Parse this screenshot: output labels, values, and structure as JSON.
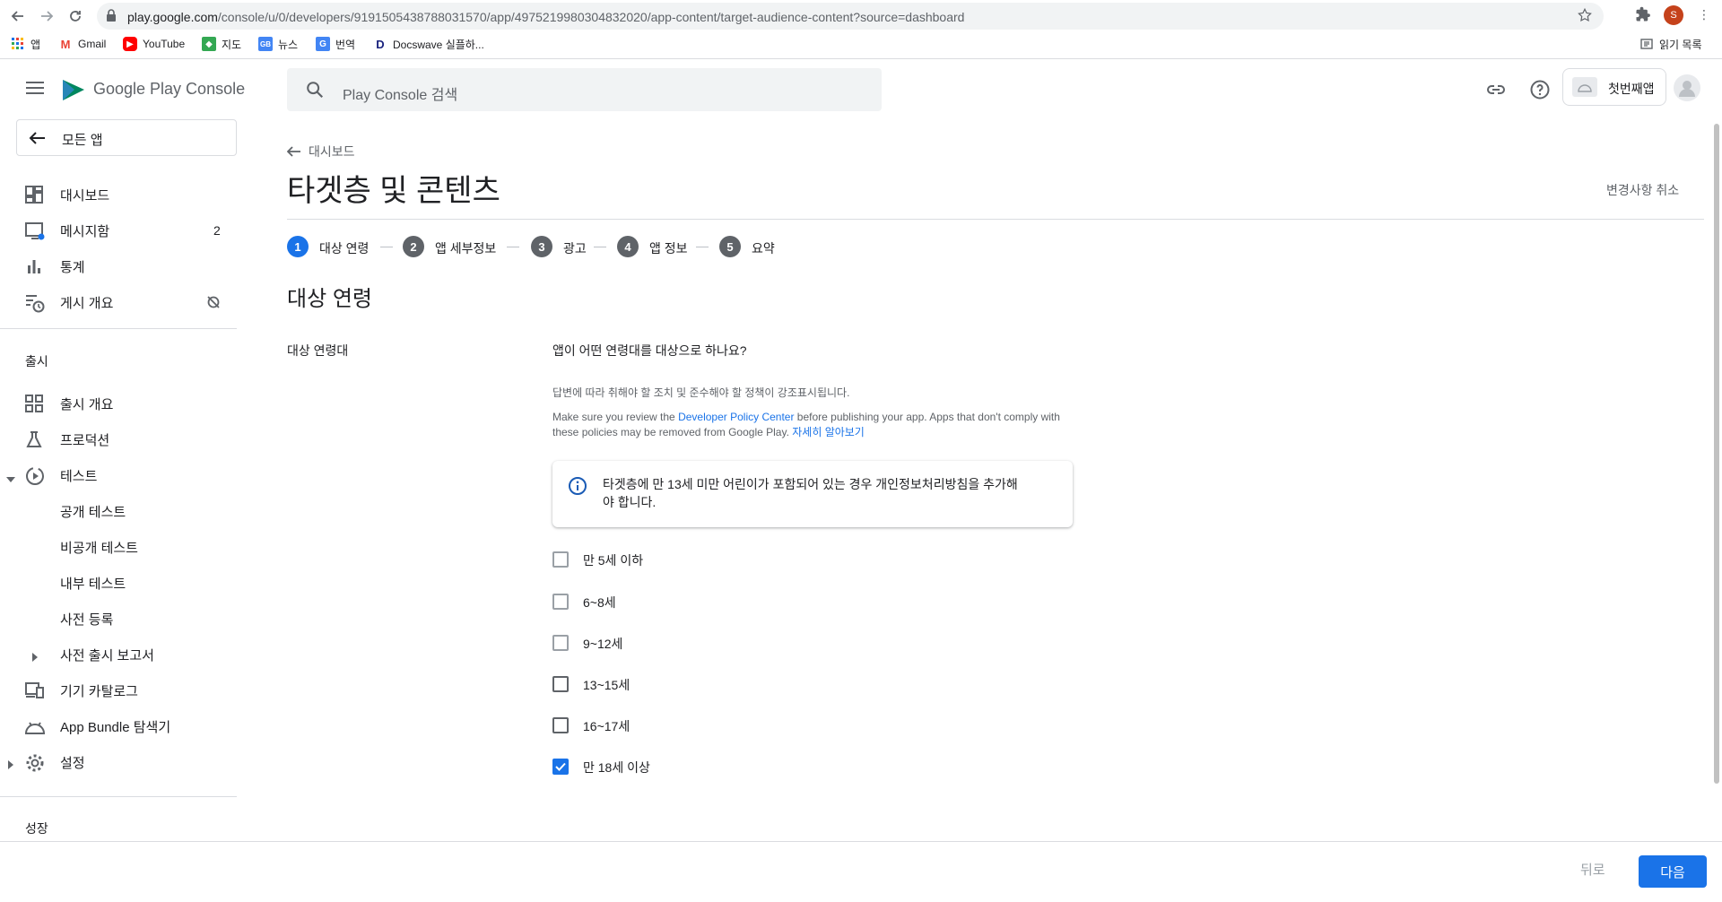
{
  "browser": {
    "url_host": "play.google.com",
    "url_path": "/console/u/0/developers/9191505438788031570/app/4975219980304832020/app-content/target-audience-content?source=dashboard",
    "profile_initial": "S",
    "bookmarks": [
      "앱",
      "Gmail",
      "YouTube",
      "지도",
      "뉴스",
      "번역",
      "Docswave 실플하..."
    ],
    "reading_list": "읽기 목록"
  },
  "header": {
    "logo_text": "Google Play Console",
    "search_placeholder": "Play Console 검색",
    "app_name": "첫번째앱"
  },
  "sidebar": {
    "all_apps": "모든 앱",
    "items": [
      {
        "label": "대시보드"
      },
      {
        "label": "메시지함",
        "badge": "2"
      },
      {
        "label": "통계"
      },
      {
        "label": "게시 개요"
      }
    ],
    "release_section": "출시",
    "release_items": [
      {
        "label": "출시 개요"
      },
      {
        "label": "프로덕션"
      },
      {
        "label": "테스트"
      },
      {
        "label": "공개 테스트"
      },
      {
        "label": "비공개 테스트"
      },
      {
        "label": "내부 테스트"
      },
      {
        "label": "사전 등록"
      },
      {
        "label": "사전 출시 보고서"
      },
      {
        "label": "기기 카탈로그"
      },
      {
        "label": "App Bundle 탐색기"
      },
      {
        "label": "설정"
      }
    ],
    "growth_section": "성장"
  },
  "main": {
    "breadcrumb": "대시보드",
    "title": "타겟층 및 콘텐츠",
    "discard": "변경사항 취소",
    "steps": [
      {
        "num": "1",
        "label": "대상 연령"
      },
      {
        "num": "2",
        "label": "앱 세부정보"
      },
      {
        "num": "3",
        "label": "광고"
      },
      {
        "num": "4",
        "label": "앱 정보"
      },
      {
        "num": "5",
        "label": "요약"
      }
    ],
    "section_title": "대상 연령",
    "field_label": "대상 연령대",
    "question": "앱이 어떤 연령대를 대상으로 하나요?",
    "helper": "답변에 따라 취해야 할 조치 및 준수해야 할 정책이 강조표시됩니다.",
    "policy_pre": "Make sure you review the ",
    "policy_link": "Developer Policy Center",
    "policy_mid": " before publishing your app. Apps that don't comply with",
    "policy_line2": "these policies may be removed from Google Play. ",
    "learn_more": "자세히 알아보기",
    "info_line1": "타겟층에 만 13세 미만 어린이가 포함되어 있는 경우 개인정보처리방침을 추가해",
    "info_line2": "야 합니다.",
    "options": [
      {
        "label": "만 5세 이하",
        "checked": false
      },
      {
        "label": "6~8세",
        "checked": false
      },
      {
        "label": "9~12세",
        "checked": false
      },
      {
        "label": "13~15세",
        "checked": false
      },
      {
        "label": "16~17세",
        "checked": false
      },
      {
        "label": "만 18세 이상",
        "checked": true
      }
    ]
  },
  "footer": {
    "back": "뒤로",
    "next": "다음"
  }
}
